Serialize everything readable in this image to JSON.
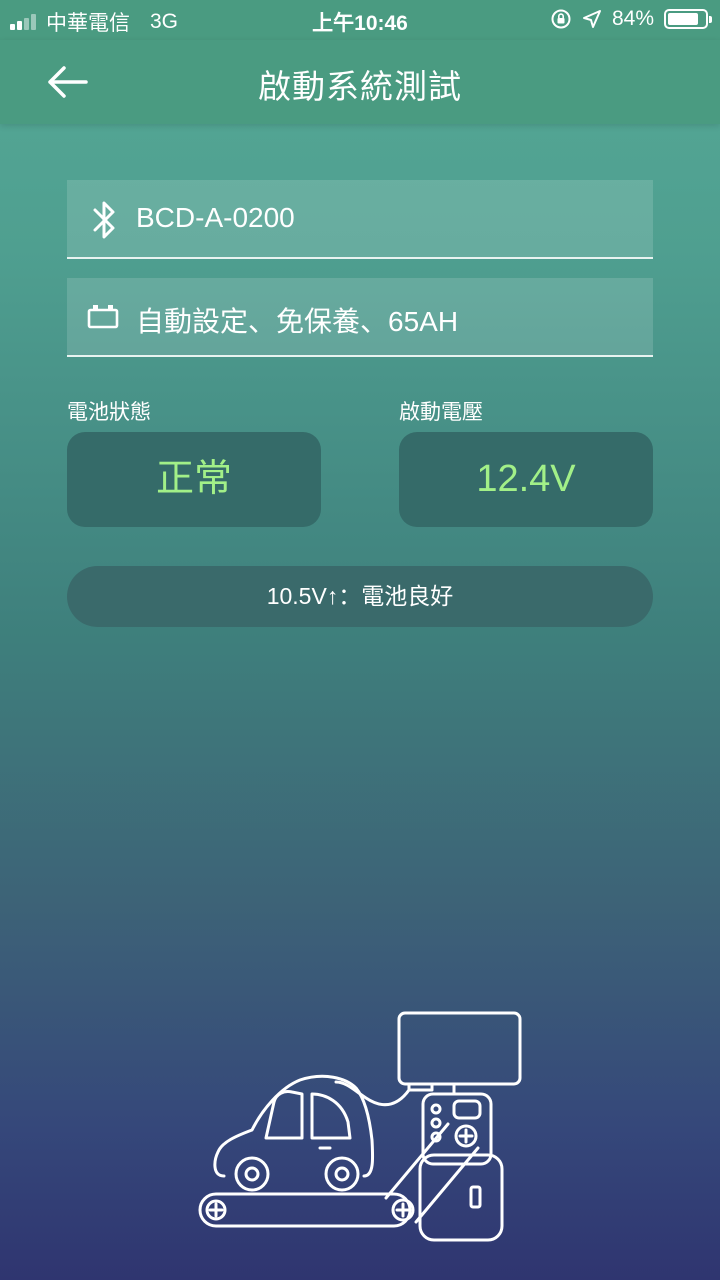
{
  "status_bar": {
    "carrier": "中華電信",
    "network": "3G",
    "time": "上午10:46",
    "battery_percent_text": "84%",
    "battery_level": 0.84
  },
  "nav": {
    "title": "啟動系統測試",
    "back_icon": "arrow-left-icon"
  },
  "device_field": {
    "icon": "bluetooth-icon",
    "value": "BCD-A-0200"
  },
  "battery_field": {
    "icon": "battery-type-icon",
    "value": "自動設定、免保養、65AH"
  },
  "results": {
    "battery_status_label": "電池狀態",
    "battery_status_value": "正常",
    "start_voltage_label": "啟動電壓",
    "start_voltage_value": "12.4V"
  },
  "hint": "10.5V↑：電池良好",
  "colors": {
    "header": "#4a9b81",
    "card": "#356b69",
    "value_green": "#a2f088"
  },
  "illustration": "car-battery-tester-illustration"
}
